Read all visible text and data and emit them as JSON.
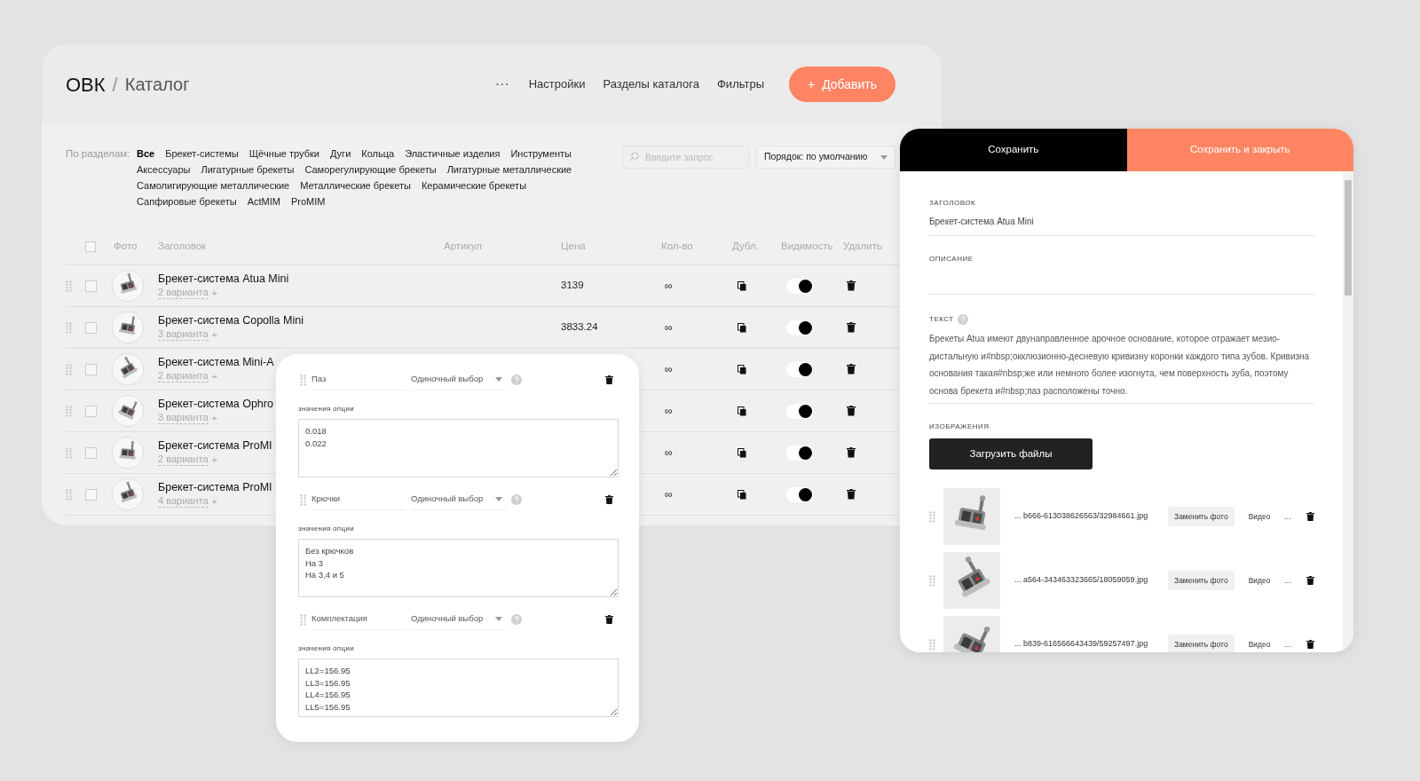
{
  "header": {
    "brand": "ОВК",
    "separator": "/",
    "title": "Каталог",
    "more": "···",
    "nav": [
      "Настройки",
      "Разделы каталога",
      "Фильтры"
    ],
    "add_button": {
      "icon": "+",
      "label": "Добавить"
    }
  },
  "filters": {
    "label": "По разделам:",
    "categories": [
      {
        "label": "Все",
        "selected": true
      },
      {
        "label": "Брекет-системы",
        "selected": false
      },
      {
        "label": "Щёчные трубки",
        "selected": false
      },
      {
        "label": "Дуги",
        "selected": false
      },
      {
        "label": "Кольца",
        "selected": false
      },
      {
        "label": "Эластичные изделия",
        "selected": false
      },
      {
        "label": "Инструменты",
        "selected": false
      },
      {
        "label": "Аксессуары",
        "selected": false
      },
      {
        "label": "Лигатурные брекеты",
        "selected": false
      },
      {
        "label": "Саморегулирующие брекеты",
        "selected": false
      },
      {
        "label": "Лигатурные металлические",
        "selected": false
      },
      {
        "label": "Самолигирующие металлические",
        "selected": false
      },
      {
        "label": "Металлические брекеты",
        "selected": false
      },
      {
        "label": "Керамические брекеты",
        "selected": false
      },
      {
        "label": "Сапфировые брекеты",
        "selected": false
      },
      {
        "label": "ActMIM",
        "selected": false
      },
      {
        "label": "ProMIM",
        "selected": false
      }
    ],
    "search": {
      "placeholder": "Введите запрос"
    },
    "sort": {
      "value": "Порядок: по умолчанию"
    }
  },
  "table": {
    "all_checked": false,
    "columns": [
      "Фото",
      "Заголовок",
      "Артикул",
      "Цена",
      "Кол-во",
      "Дубл.",
      "Видимость",
      "Удалить"
    ],
    "rows": [
      {
        "title": "Брекет-система Atua Mini",
        "variants": "2 варианта",
        "add": "+",
        "price": "3139",
        "quantity": "∞",
        "checked": false,
        "visible": true
      },
      {
        "title": "Брекет-система Copolla Mini",
        "variants": "3 варианта",
        "add": "+",
        "price": "3833.24",
        "quantity": "∞",
        "checked": false,
        "visible": true
      },
      {
        "title": "Брекет-система Mini-A",
        "variants": "2 варианта",
        "add": "+",
        "quantity": "∞",
        "checked": false,
        "visible": true
      },
      {
        "title": "Брекет-система Ophro",
        "variants": "3 варианта",
        "add": "+",
        "quantity": "∞",
        "checked": false,
        "visible": true
      },
      {
        "title": "Брекет-система ProMI",
        "variants": "2 варианта",
        "add": "+",
        "quantity": "∞",
        "checked": false,
        "visible": true
      },
      {
        "title": "Брекет-система ProMI",
        "variants": "4 варианта",
        "add": "+",
        "quantity": "∞",
        "checked": false,
        "visible": true
      }
    ]
  },
  "option_editor": {
    "options": [
      {
        "name": "Паз",
        "type": "Одиночный выбор",
        "values_label": "значения опции",
        "values": "0.018\n0.022"
      },
      {
        "name": "Крючки",
        "type": "Одиночный выбор",
        "values_label": "значения опции",
        "values": "Без крючков\nНа 3\nНа 3,4 и 5"
      },
      {
        "name": "Комплектация",
        "type": "Одиночный выбор",
        "values_label": "значения опции",
        "values": "LL2=156.95\nLL3=156.95\nLL4=156.95\nLL5=156.95"
      }
    ]
  },
  "editor": {
    "save": "Сохранить",
    "save_close": "Сохранить и закрыть",
    "title_field": {
      "label": "ЗАГОЛОВОК",
      "value": "Брекет-система Atua Mini"
    },
    "description_field": {
      "label": "ОПИСАНИЕ"
    },
    "text_field": {
      "label": "ТЕКСТ",
      "value": "Брекеты Atua имеют двунаправленное арочное основание, которое отражает мезио-дистальную и#nbsp;окклюзионно-десневую кривизну коронки каждого типа зубов. Кривизна основания такая#nbsp;же или немного более изогнута, чем поверхность зуба, поэтому основа брекета и#nbsp;паз расположены точно."
    },
    "images": {
      "label": "ИЗОБРАЖЕНИЯ",
      "upload": "Загрузить файлы",
      "items": [
        {
          "file": "... b666-613038626563/32984661.jpg",
          "replace": "Заменить фото",
          "video": "Видео",
          "more": "..."
        },
        {
          "file": "... a564-343463323665/18059059.jpg",
          "replace": "Заменить фото",
          "video": "Видео",
          "more": "..."
        },
        {
          "file": "... b839-616566643439/59257497.jpg",
          "replace": "Заменить фото",
          "video": "Видео",
          "more": "..."
        }
      ]
    }
  }
}
